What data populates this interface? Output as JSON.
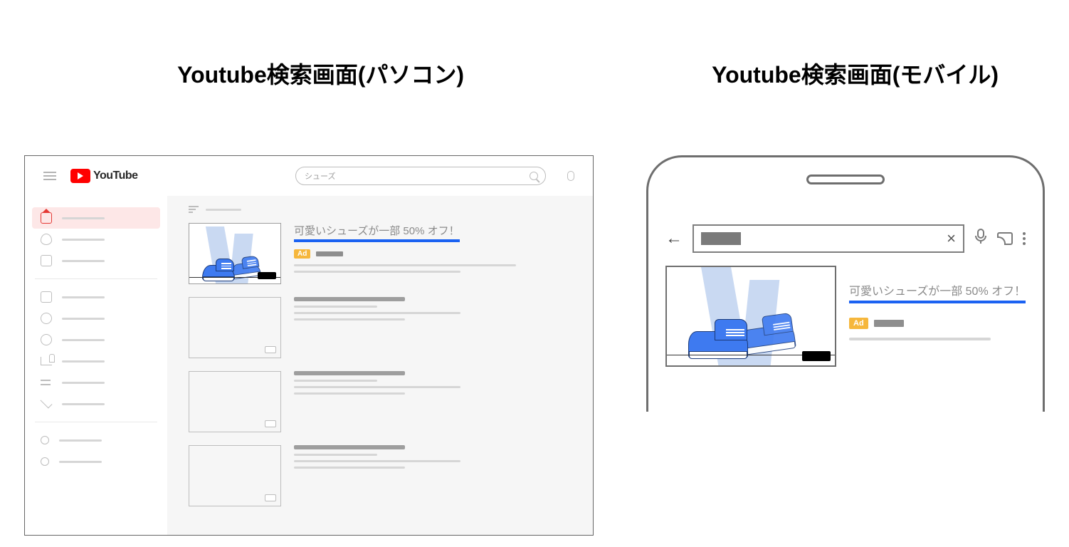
{
  "titles": {
    "desktop": "Youtube検索画面(パソコン)",
    "mobile": "Youtube検索画面(モバイル)"
  },
  "desktop": {
    "logo_text": "YouTube",
    "search_query": "シューズ",
    "ad": {
      "headline": "可愛いシューズが一部 50% オフ！",
      "badge": "Ad"
    }
  },
  "mobile": {
    "ad": {
      "headline": "可愛いシューズが一部 50% オフ！",
      "badge": "Ad"
    }
  }
}
